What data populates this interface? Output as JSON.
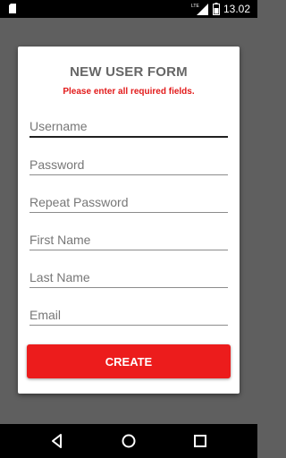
{
  "status_bar": {
    "network": "LTE",
    "time": "13.02",
    "icons": [
      "sd-card-icon",
      "signal-icon",
      "battery-icon"
    ]
  },
  "form": {
    "title": "NEW USER FORM",
    "message": "Please enter all required fields.",
    "message_color": "#e21a1a",
    "fields": [
      {
        "placeholder": "Username",
        "value": ""
      },
      {
        "placeholder": "Password",
        "value": ""
      },
      {
        "placeholder": "Repeat Password",
        "value": ""
      },
      {
        "placeholder": "First Name",
        "value": ""
      },
      {
        "placeholder": "Last Name",
        "value": ""
      },
      {
        "placeholder": "Email",
        "value": ""
      }
    ],
    "submit_label": "CREATE",
    "accent": "#ec1c1c"
  },
  "nav_bar": {
    "buttons": [
      "back-icon",
      "home-icon",
      "recents-icon"
    ]
  }
}
